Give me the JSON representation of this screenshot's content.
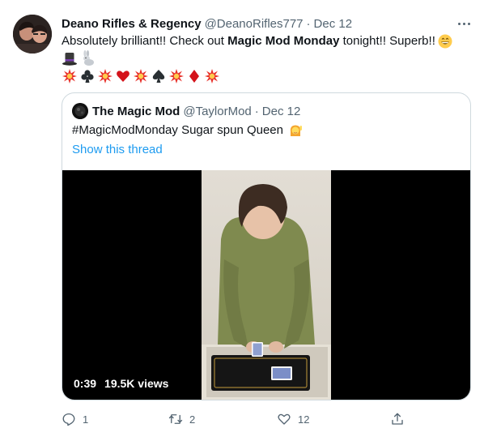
{
  "tweet": {
    "display_name": "Deano Rifles & Regency",
    "handle": "@DeanoRifles777",
    "separator": "·",
    "date": "Dec 12",
    "text_before": "Absolutely brilliant!! Check out ",
    "text_bold": "Magic Mod Monday",
    "text_after": " tonight!! Superb!!",
    "emoji_line1": [
      "grinning-face",
      "top-hat",
      "rabbit"
    ],
    "emoji_line2": [
      "collision",
      "club-suit",
      "collision",
      "heart-suit",
      "collision",
      "spade-suit",
      "collision",
      "diamond-suit",
      "collision"
    ]
  },
  "quoted": {
    "display_name": "The Magic Mod",
    "handle": "@TaylorMod",
    "separator": "·",
    "date": "Dec 12",
    "text": "#MagicModMonday Sugar spun Queen",
    "text_emoji": "person-raising-hand",
    "show_thread": "Show this thread",
    "video": {
      "duration": "0:39",
      "views": "19.5K views"
    }
  },
  "actions": {
    "reply_count": "1",
    "retweet_count": "2",
    "like_count": "12"
  },
  "colors": {
    "link": "#1d9bf0",
    "secondary_text": "#536471",
    "border": "#cfd9de",
    "collision": "#e8322b",
    "card_red": "#d4131b"
  }
}
